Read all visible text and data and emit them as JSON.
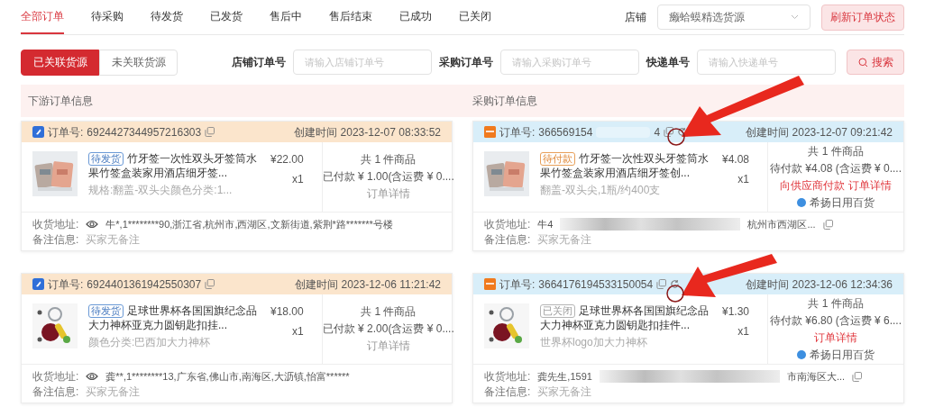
{
  "tabs": [
    {
      "label": "全部订单",
      "selected": true
    },
    {
      "label": "待采购",
      "selected": false
    },
    {
      "label": "待发货",
      "selected": false
    },
    {
      "label": "已发货",
      "selected": false
    },
    {
      "label": "售后中",
      "selected": false
    },
    {
      "label": "售后结束",
      "selected": false
    },
    {
      "label": "已成功",
      "selected": false
    },
    {
      "label": "已关闭",
      "selected": false
    }
  ],
  "store_filter": {
    "label": "店铺",
    "value": "癞蛤蟆精选货源"
  },
  "refresh_button": "刷新订单状态",
  "source_toggle": [
    {
      "label": "已关联货源",
      "selected": true
    },
    {
      "label": "未关联货源",
      "selected": false
    }
  ],
  "search_fields": [
    {
      "label": "店铺订单号",
      "placeholder": "请输入店铺订单号"
    },
    {
      "label": "采购订单号",
      "placeholder": "请输入采购订单号"
    },
    {
      "label": "快递单号",
      "placeholder": "请输入快递单号"
    }
  ],
  "search_button": "搜索",
  "columns": [
    "下游订单信息",
    "采购订单信息"
  ],
  "rows": [
    {
      "downstream": {
        "kind": "sales",
        "order_label": "订单号:",
        "order_no": [
          {
            "kind": "text",
            "text": "6924427344957216303"
          }
        ],
        "refresh_icon": false,
        "created": "创建时间 2023-12-07 08:33:52",
        "status": {
          "label": "待发货",
          "kind": "shipping"
        },
        "title": "竹牙签一次性双头牙签筒水果竹签盒装家用酒店细牙签...",
        "spec": "规格:翻盖-双头尖颜色分类:1...",
        "price": "¥22.00",
        "qty": "x1",
        "summary": "共 1 件商品",
        "payment": "已付款 ¥ 1.00(含运费 ¥ 0....",
        "links": [
          {
            "label": "订单详情",
            "kind": "muted"
          }
        ],
        "address_label": "收货地址:",
        "masked": true,
        "address": [
          {
            "kind": "text",
            "text": "牛*,1********90,浙江省,杭州市,西湖区,文新街道,紫荆*路*******号楼"
          }
        ],
        "address_copy": false,
        "remark_label": "备注信息:",
        "remark": "买家无备注"
      },
      "purchase": {
        "kind": "purchase",
        "order_label": "订单号:",
        "order_no": [
          {
            "kind": "text",
            "text": "366569154"
          },
          {
            "kind": "redacted"
          },
          {
            "kind": "text",
            "text": "4"
          }
        ],
        "refresh_icon": true,
        "created": "创建时间 2023-12-07 09:21:42",
        "status": {
          "label": "待付款",
          "kind": "unpaid"
        },
        "title": "竹牙签一次性双头牙签筒水果竹签盒装家用酒店细牙签创...",
        "spec": "翻盖-双头尖,1瓶/约400支",
        "price": "¥4.08",
        "qty": "x1",
        "summary": "共 1 件商品",
        "payment": "待付款 ¥4.08 (含运费 ¥ 0....",
        "links": [
          {
            "label": "向供应商付款",
            "kind": "primary"
          },
          {
            "label": "订单详情",
            "kind": "primary"
          }
        ],
        "supplier": "希扬日用百货",
        "address_label": "收货地址:",
        "masked": false,
        "address": [
          {
            "kind": "text",
            "text": "牛4"
          },
          {
            "kind": "redacted"
          },
          {
            "kind": "text",
            "text": "杭州市西湖区..."
          }
        ],
        "address_copy": true,
        "remark_label": "备注信息:",
        "remark": "买家无备注"
      }
    },
    {
      "downstream": {
        "kind": "sales",
        "order_label": "订单号:",
        "order_no": [
          {
            "kind": "text",
            "text": "6924401361942550307"
          }
        ],
        "refresh_icon": false,
        "created": "创建时间 2023-12-06 11:21:42",
        "status": {
          "label": "待发货",
          "kind": "shipping"
        },
        "title": "足球世界杯各国国旗纪念品大力神杯亚克力圆钥匙扣挂...",
        "spec": "颜色分类:巴西加大力神杯",
        "price": "¥18.00",
        "qty": "x1",
        "summary": "共 1 件商品",
        "payment": "已付款 ¥ 2.00(含运费 ¥ 0....",
        "links": [
          {
            "label": "订单详情",
            "kind": "muted"
          }
        ],
        "address_label": "收货地址:",
        "masked": true,
        "address": [
          {
            "kind": "text",
            "text": "龚**,1********13,广东省,佛山市,南海区,大沥镇,怡富******"
          }
        ],
        "address_copy": false,
        "remark_label": "备注信息:",
        "remark": "买家无备注"
      },
      "purchase": {
        "kind": "purchase",
        "order_label": "订单号:",
        "order_no": [
          {
            "kind": "text",
            "text": "3664176194533150054"
          }
        ],
        "refresh_icon": true,
        "created": "创建时间 2023-12-06 12:34:36",
        "status": {
          "label": "已关闭",
          "kind": "closed"
        },
        "title": "足球世界杯各国国旗纪念品大力神杯亚克力圆钥匙扣挂件...",
        "spec": "世界杯logo加大力神杯",
        "price": "¥1.30",
        "qty": "x1",
        "summary": "共 1 件商品",
        "payment": "待付款 ¥6.80 (含运费 ¥ 6....",
        "links": [
          {
            "label": "订单详情",
            "kind": "primary"
          }
        ],
        "supplier": "希扬日用百货",
        "address_label": "收货地址:",
        "masked": false,
        "address": [
          {
            "kind": "text",
            "text": "龚先生,1591"
          },
          {
            "kind": "redacted"
          },
          {
            "kind": "text",
            "text": "市南海区大..."
          }
        ],
        "address_copy": true,
        "remark_label": "备注信息:",
        "remark": "买家无备注"
      }
    }
  ]
}
